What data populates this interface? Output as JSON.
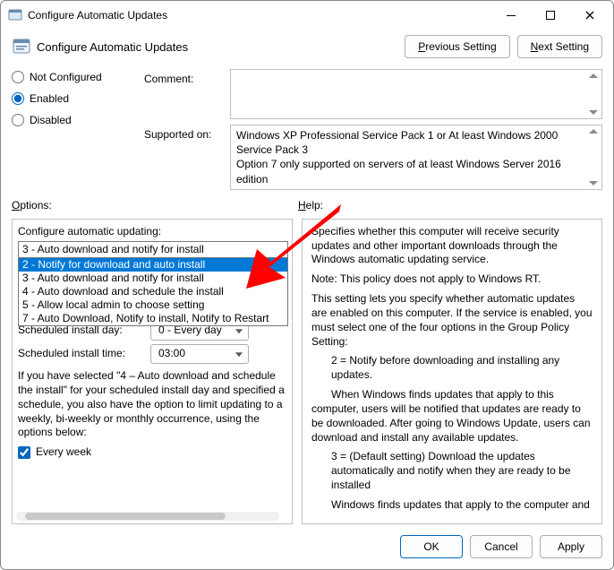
{
  "window": {
    "title": "Configure Automatic Updates"
  },
  "header": {
    "setting_name": "Configure Automatic Updates",
    "prev_button": "Previous Setting",
    "next_button": "Next Setting"
  },
  "radios": {
    "not_configured": "Not Configured",
    "enabled": "Enabled",
    "disabled": "Disabled",
    "selected": "enabled"
  },
  "fields": {
    "comment_label": "Comment:",
    "supported_label": "Supported on:",
    "supported_text": "Windows XP Professional Service Pack 1 or At least Windows 2000 Service Pack 3\nOption 7 only supported on servers of at least Windows Server 2016 edition"
  },
  "panel_labels": {
    "options": "Options:",
    "help": "Help:"
  },
  "options": {
    "heading": "Configure automatic updating:",
    "dropdown_selected": "3 - Auto download and notify for install",
    "dropdown_items": [
      "2 - Notify for download and auto install",
      "3 - Auto download and notify for install",
      "4 - Auto download and schedule the install",
      "5 - Allow local admin to choose setting",
      "7 - Auto Download, Notify to install, Notify to Restart"
    ],
    "dropdown_highlight_index": 0,
    "install_day_label": "Scheduled install day:",
    "install_day_value": "0 - Every day",
    "install_time_label": "Scheduled install time:",
    "install_time_value": "03:00",
    "paragraph": "If you have selected \"4 – Auto download and schedule the install\" for your scheduled install day and specified a schedule, you also have the option to limit updating to a weekly, bi-weekly or monthly occurrence, using the options below:",
    "every_week_label": "Every week",
    "every_week_checked": true
  },
  "help": {
    "p1": "Specifies whether this computer will receive security updates and other important downloads through the Windows automatic updating service.",
    "p2": "Note: This policy does not apply to Windows RT.",
    "p3": "This setting lets you specify whether automatic updates are enabled on this computer. If the service is enabled, you must select one of the four options in the Group Policy Setting:",
    "p4": "2 = Notify before downloading and installing any updates.",
    "p5": "When Windows finds updates that apply to this computer, users will be notified that updates are ready to be downloaded. After going to Windows Update, users can download and install any available updates.",
    "p6": "3 = (Default setting) Download the updates automatically and notify when they are ready to be installed",
    "p7": "Windows finds updates that apply to the computer and"
  },
  "footer": {
    "ok": "OK",
    "cancel": "Cancel",
    "apply": "Apply"
  }
}
